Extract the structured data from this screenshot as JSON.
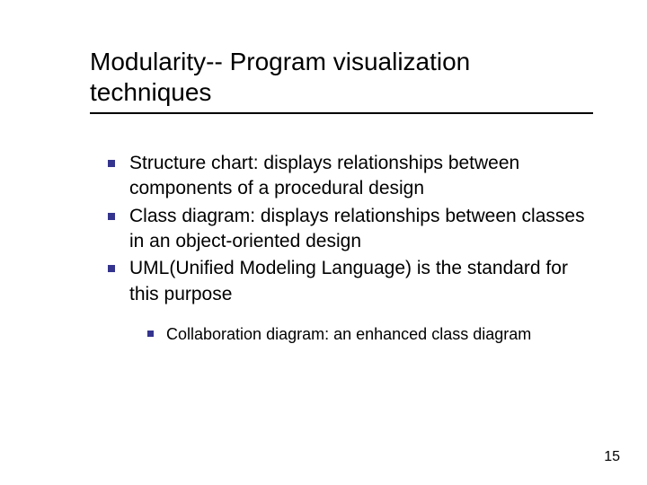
{
  "slide": {
    "title": "Modularity-- Program visualization techniques",
    "bullets": [
      "Structure chart: displays relationships between components of a procedural design",
      "Class diagram: displays relationships between classes in an object-oriented design",
      "UML(Unified Modeling Language) is the standard for this purpose"
    ],
    "sub_bullets": [
      "Collaboration diagram: an enhanced class diagram"
    ],
    "page_number": "15"
  }
}
